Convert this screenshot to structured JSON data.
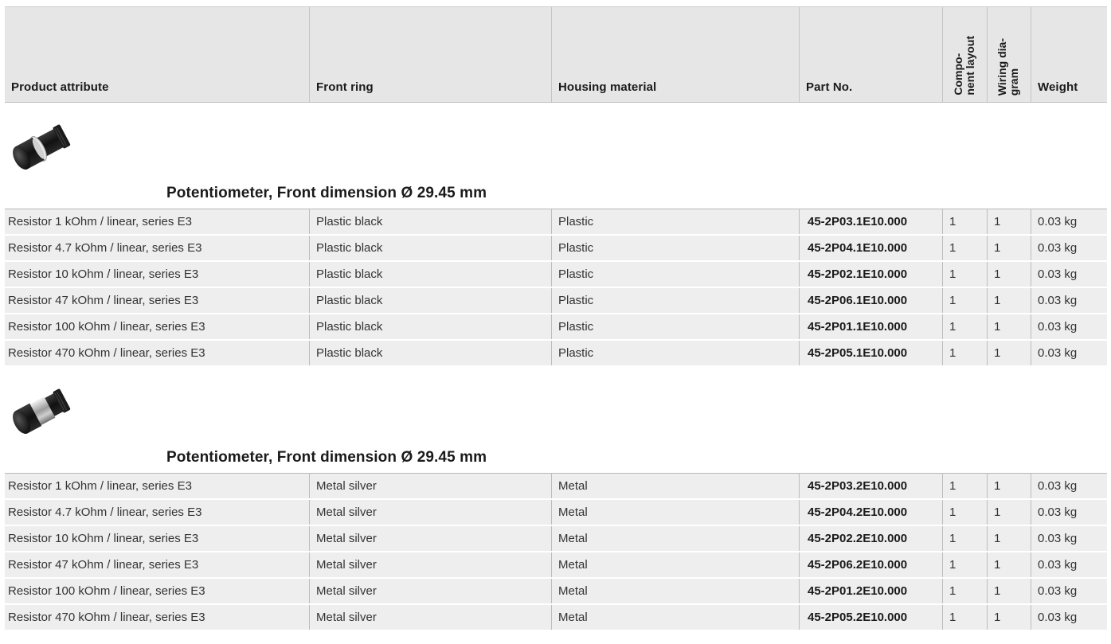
{
  "header": {
    "attr": "Product attribute",
    "ring": "Front ring",
    "housing": "Housing material",
    "part": "Part No.",
    "layout": "Compo-\nnent layout",
    "wiring": "Wiring dia-\ngram",
    "weight": "Weight"
  },
  "sections": [
    {
      "title": "Potentiometer, Front dimension Ø 29.45 mm",
      "image": "potentiometer-black-ring-image",
      "rows": [
        {
          "attr": "Resistor 1 kOhm / linear, series E3",
          "ring": "Plastic black",
          "housing": "Plastic",
          "part": "45-2P03.1E10.000",
          "layout": "1",
          "wiring": "1",
          "weight": "0.03 kg"
        },
        {
          "attr": "Resistor 4.7 kOhm / linear, series E3",
          "ring": "Plastic black",
          "housing": "Plastic",
          "part": "45-2P04.1E10.000",
          "layout": "1",
          "wiring": "1",
          "weight": "0.03 kg"
        },
        {
          "attr": "Resistor 10 kOhm / linear, series E3",
          "ring": "Plastic black",
          "housing": "Plastic",
          "part": "45-2P02.1E10.000",
          "layout": "1",
          "wiring": "1",
          "weight": "0.03 kg"
        },
        {
          "attr": "Resistor 47 kOhm / linear, series E3",
          "ring": "Plastic black",
          "housing": "Plastic",
          "part": "45-2P06.1E10.000",
          "layout": "1",
          "wiring": "1",
          "weight": "0.03 kg"
        },
        {
          "attr": "Resistor 100 kOhm / linear, series E3",
          "ring": "Plastic black",
          "housing": "Plastic",
          "part": "45-2P01.1E10.000",
          "layout": "1",
          "wiring": "1",
          "weight": "0.03 kg"
        },
        {
          "attr": "Resistor 470 kOhm / linear, series E3",
          "ring": "Plastic black",
          "housing": "Plastic",
          "part": "45-2P05.1E10.000",
          "layout": "1",
          "wiring": "1",
          "weight": "0.03 kg"
        }
      ]
    },
    {
      "title": "Potentiometer, Front dimension Ø 29.45 mm",
      "image": "potentiometer-silver-ring-image",
      "rows": [
        {
          "attr": "Resistor 1 kOhm / linear, series E3",
          "ring": "Metal silver",
          "housing": "Metal",
          "part": "45-2P03.2E10.000",
          "layout": "1",
          "wiring": "1",
          "weight": "0.03 kg"
        },
        {
          "attr": "Resistor 4.7 kOhm / linear, series E3",
          "ring": "Metal silver",
          "housing": "Metal",
          "part": "45-2P04.2E10.000",
          "layout": "1",
          "wiring": "1",
          "weight": "0.03 kg"
        },
        {
          "attr": "Resistor 10 kOhm / linear, series E3",
          "ring": "Metal silver",
          "housing": "Metal",
          "part": "45-2P02.2E10.000",
          "layout": "1",
          "wiring": "1",
          "weight": "0.03 kg"
        },
        {
          "attr": "Resistor 47 kOhm / linear, series E3",
          "ring": "Metal silver",
          "housing": "Metal",
          "part": "45-2P06.2E10.000",
          "layout": "1",
          "wiring": "1",
          "weight": "0.03 kg"
        },
        {
          "attr": "Resistor 100 kOhm / linear, series E3",
          "ring": "Metal silver",
          "housing": "Metal",
          "part": "45-2P01.2E10.000",
          "layout": "1",
          "wiring": "1",
          "weight": "0.03 kg"
        },
        {
          "attr": "Resistor 470 kOhm / linear, series E3",
          "ring": "Metal silver",
          "housing": "Metal",
          "part": "45-2P05.2E10.000",
          "layout": "1",
          "wiring": "1",
          "weight": "0.03 kg"
        }
      ]
    }
  ]
}
